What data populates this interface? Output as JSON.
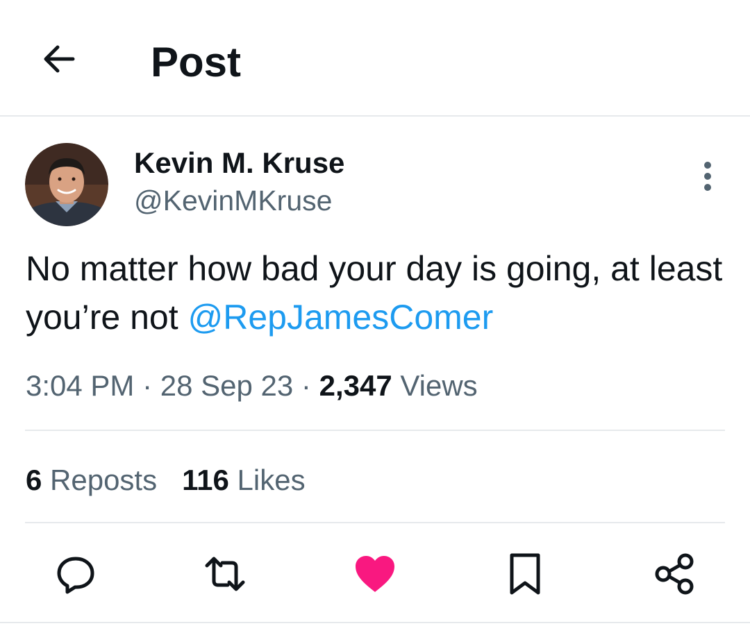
{
  "header": {
    "title": "Post",
    "back_icon": "arrow-left-icon"
  },
  "author": {
    "display_name": "Kevin M. Kruse",
    "handle": "@KevinMKruse",
    "avatar_icon": "user-avatar-photo"
  },
  "tweet": {
    "text_before": "No matter how bad your day is going, at least you’re not ",
    "mention": "@RepJamesComer"
  },
  "meta": {
    "time": "3:04 PM",
    "sep1": " · ",
    "date": "28 Sep 23",
    "sep2": " · ",
    "views_count": "2,347",
    "views_label": " Views"
  },
  "stats": {
    "reposts_count": "6",
    "reposts_label": " Reposts",
    "likes_count": "116",
    "likes_label": " Likes"
  },
  "actions": {
    "reply_icon": "reply-icon",
    "repost_icon": "repost-icon",
    "like_icon": "heart-icon",
    "bookmark_icon": "bookmark-icon",
    "share_icon": "share-icon"
  },
  "colors": {
    "text": "#0f1419",
    "secondary": "#536471",
    "link": "#1d9bf0",
    "like": "#f91880",
    "divider": "#e6e9ec"
  }
}
